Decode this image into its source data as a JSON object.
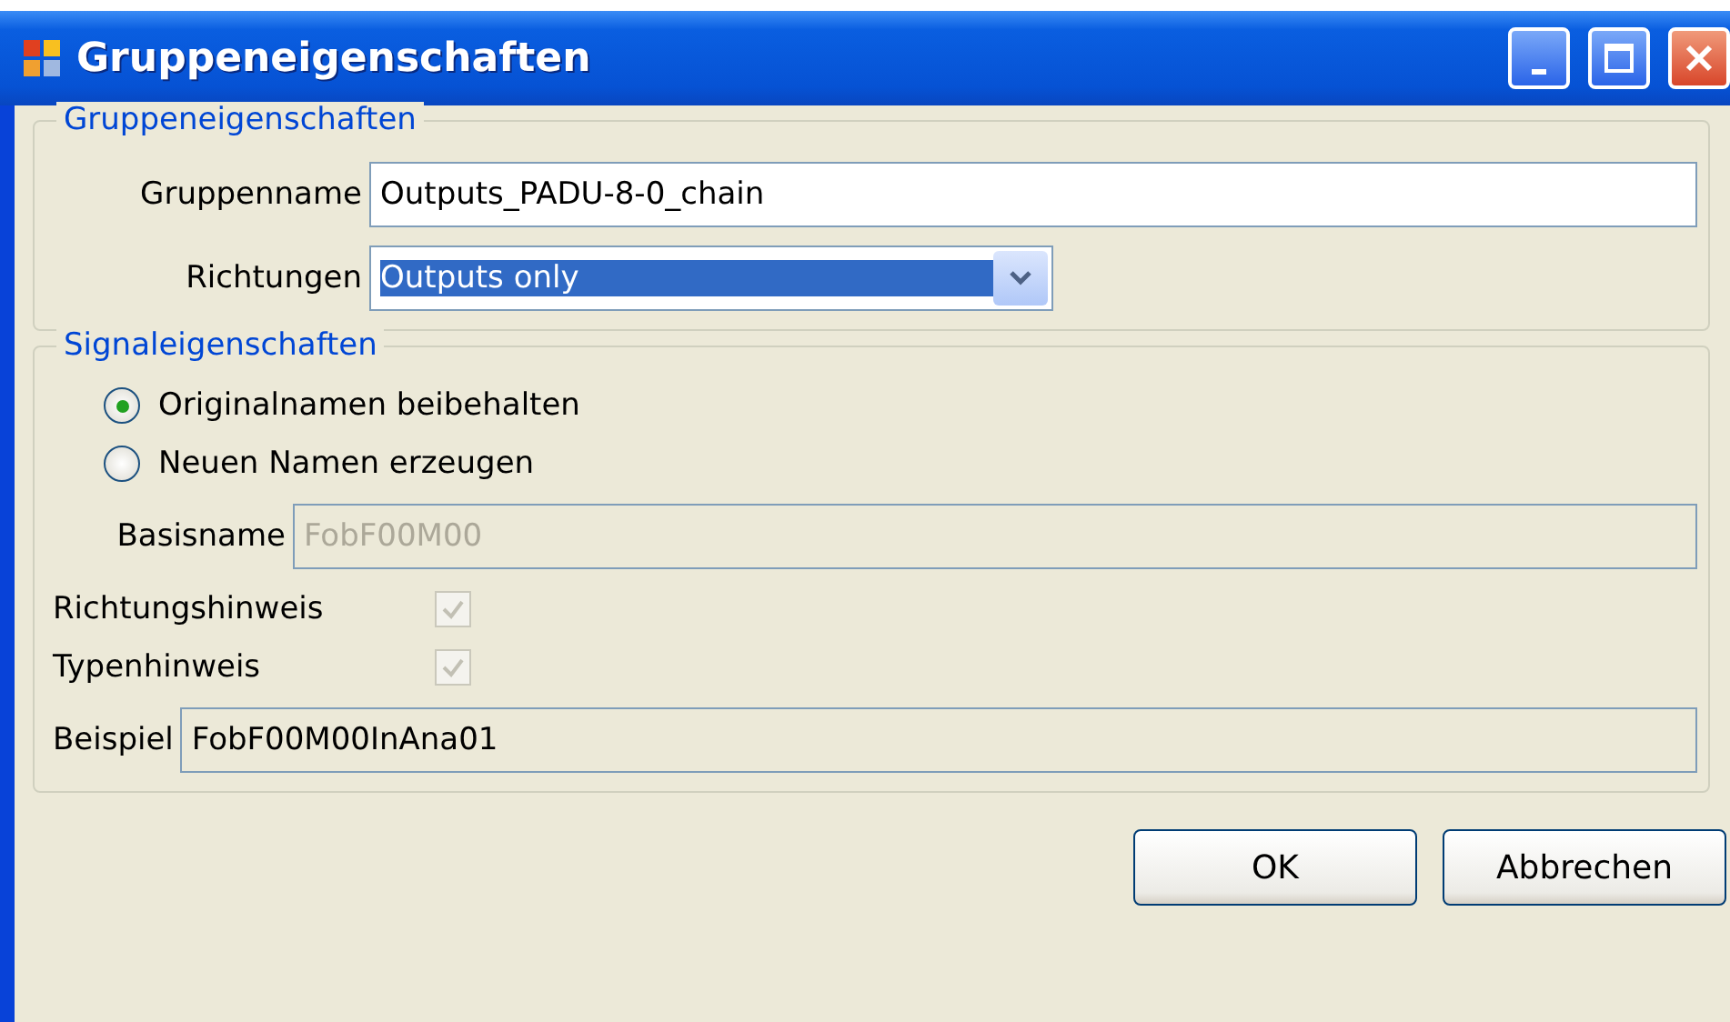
{
  "window": {
    "title": "Gruppeneigenschaften"
  },
  "group_properties": {
    "title": "Gruppeneigenschaften",
    "group_name": {
      "label": "Gruppenname",
      "value": "Outputs_PADU-8-0_chain"
    },
    "directions": {
      "label": "Richtungen",
      "value": "Outputs only",
      "highlighted": true
    }
  },
  "signal_properties": {
    "title": "Signaleigenschaften",
    "naming": [
      {
        "label": "Originalnamen beibehalten",
        "selected": true
      },
      {
        "label": "Neuen Namen erzeugen",
        "selected": false
      }
    ],
    "base_name": {
      "label": "Basisname",
      "value": "FobF00M00",
      "disabled": true
    },
    "hints": [
      {
        "label": "Richtungshinweis",
        "checked": true,
        "disabled": true
      },
      {
        "label": "Typenhinweis",
        "checked": true,
        "disabled": true
      }
    ],
    "example": {
      "label": "Beispiel",
      "value": "FobF00M00InAna01"
    }
  },
  "buttons": [
    "OK",
    "Abbrechen"
  ]
}
